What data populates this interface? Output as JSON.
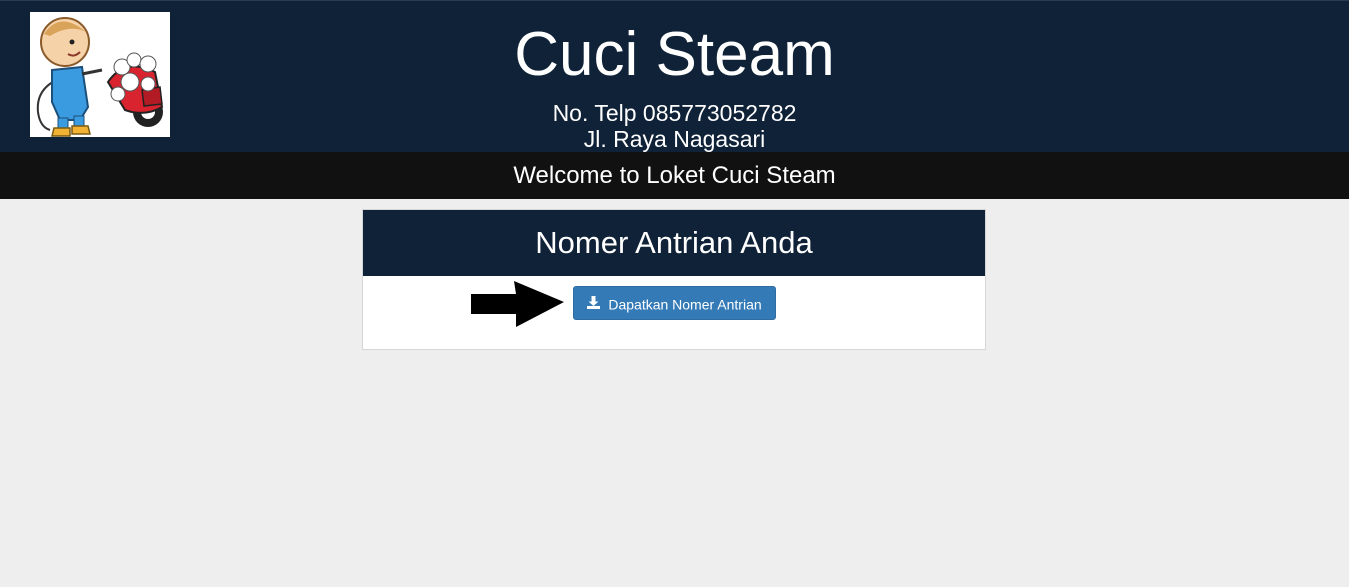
{
  "header": {
    "title": "Cuci Steam",
    "phone_label": "No. Telp",
    "phone_number": "085773052782",
    "address": "Jl. Raya Nagasari",
    "logo_icon": "cartoon-washer-logo"
  },
  "welcome": {
    "text": "Welcome to Loket Cuci Steam"
  },
  "queue_panel": {
    "heading": "Nomer Antrian Anda",
    "button_label": "Dapatkan Nomer Antrian",
    "button_icon": "download-icon",
    "pointer_icon": "arrow-right-icon"
  },
  "colors": {
    "header_bg": "#0f2238",
    "welcome_bg": "#111111",
    "page_bg": "#eeeeee",
    "button_bg": "#337ab7"
  }
}
